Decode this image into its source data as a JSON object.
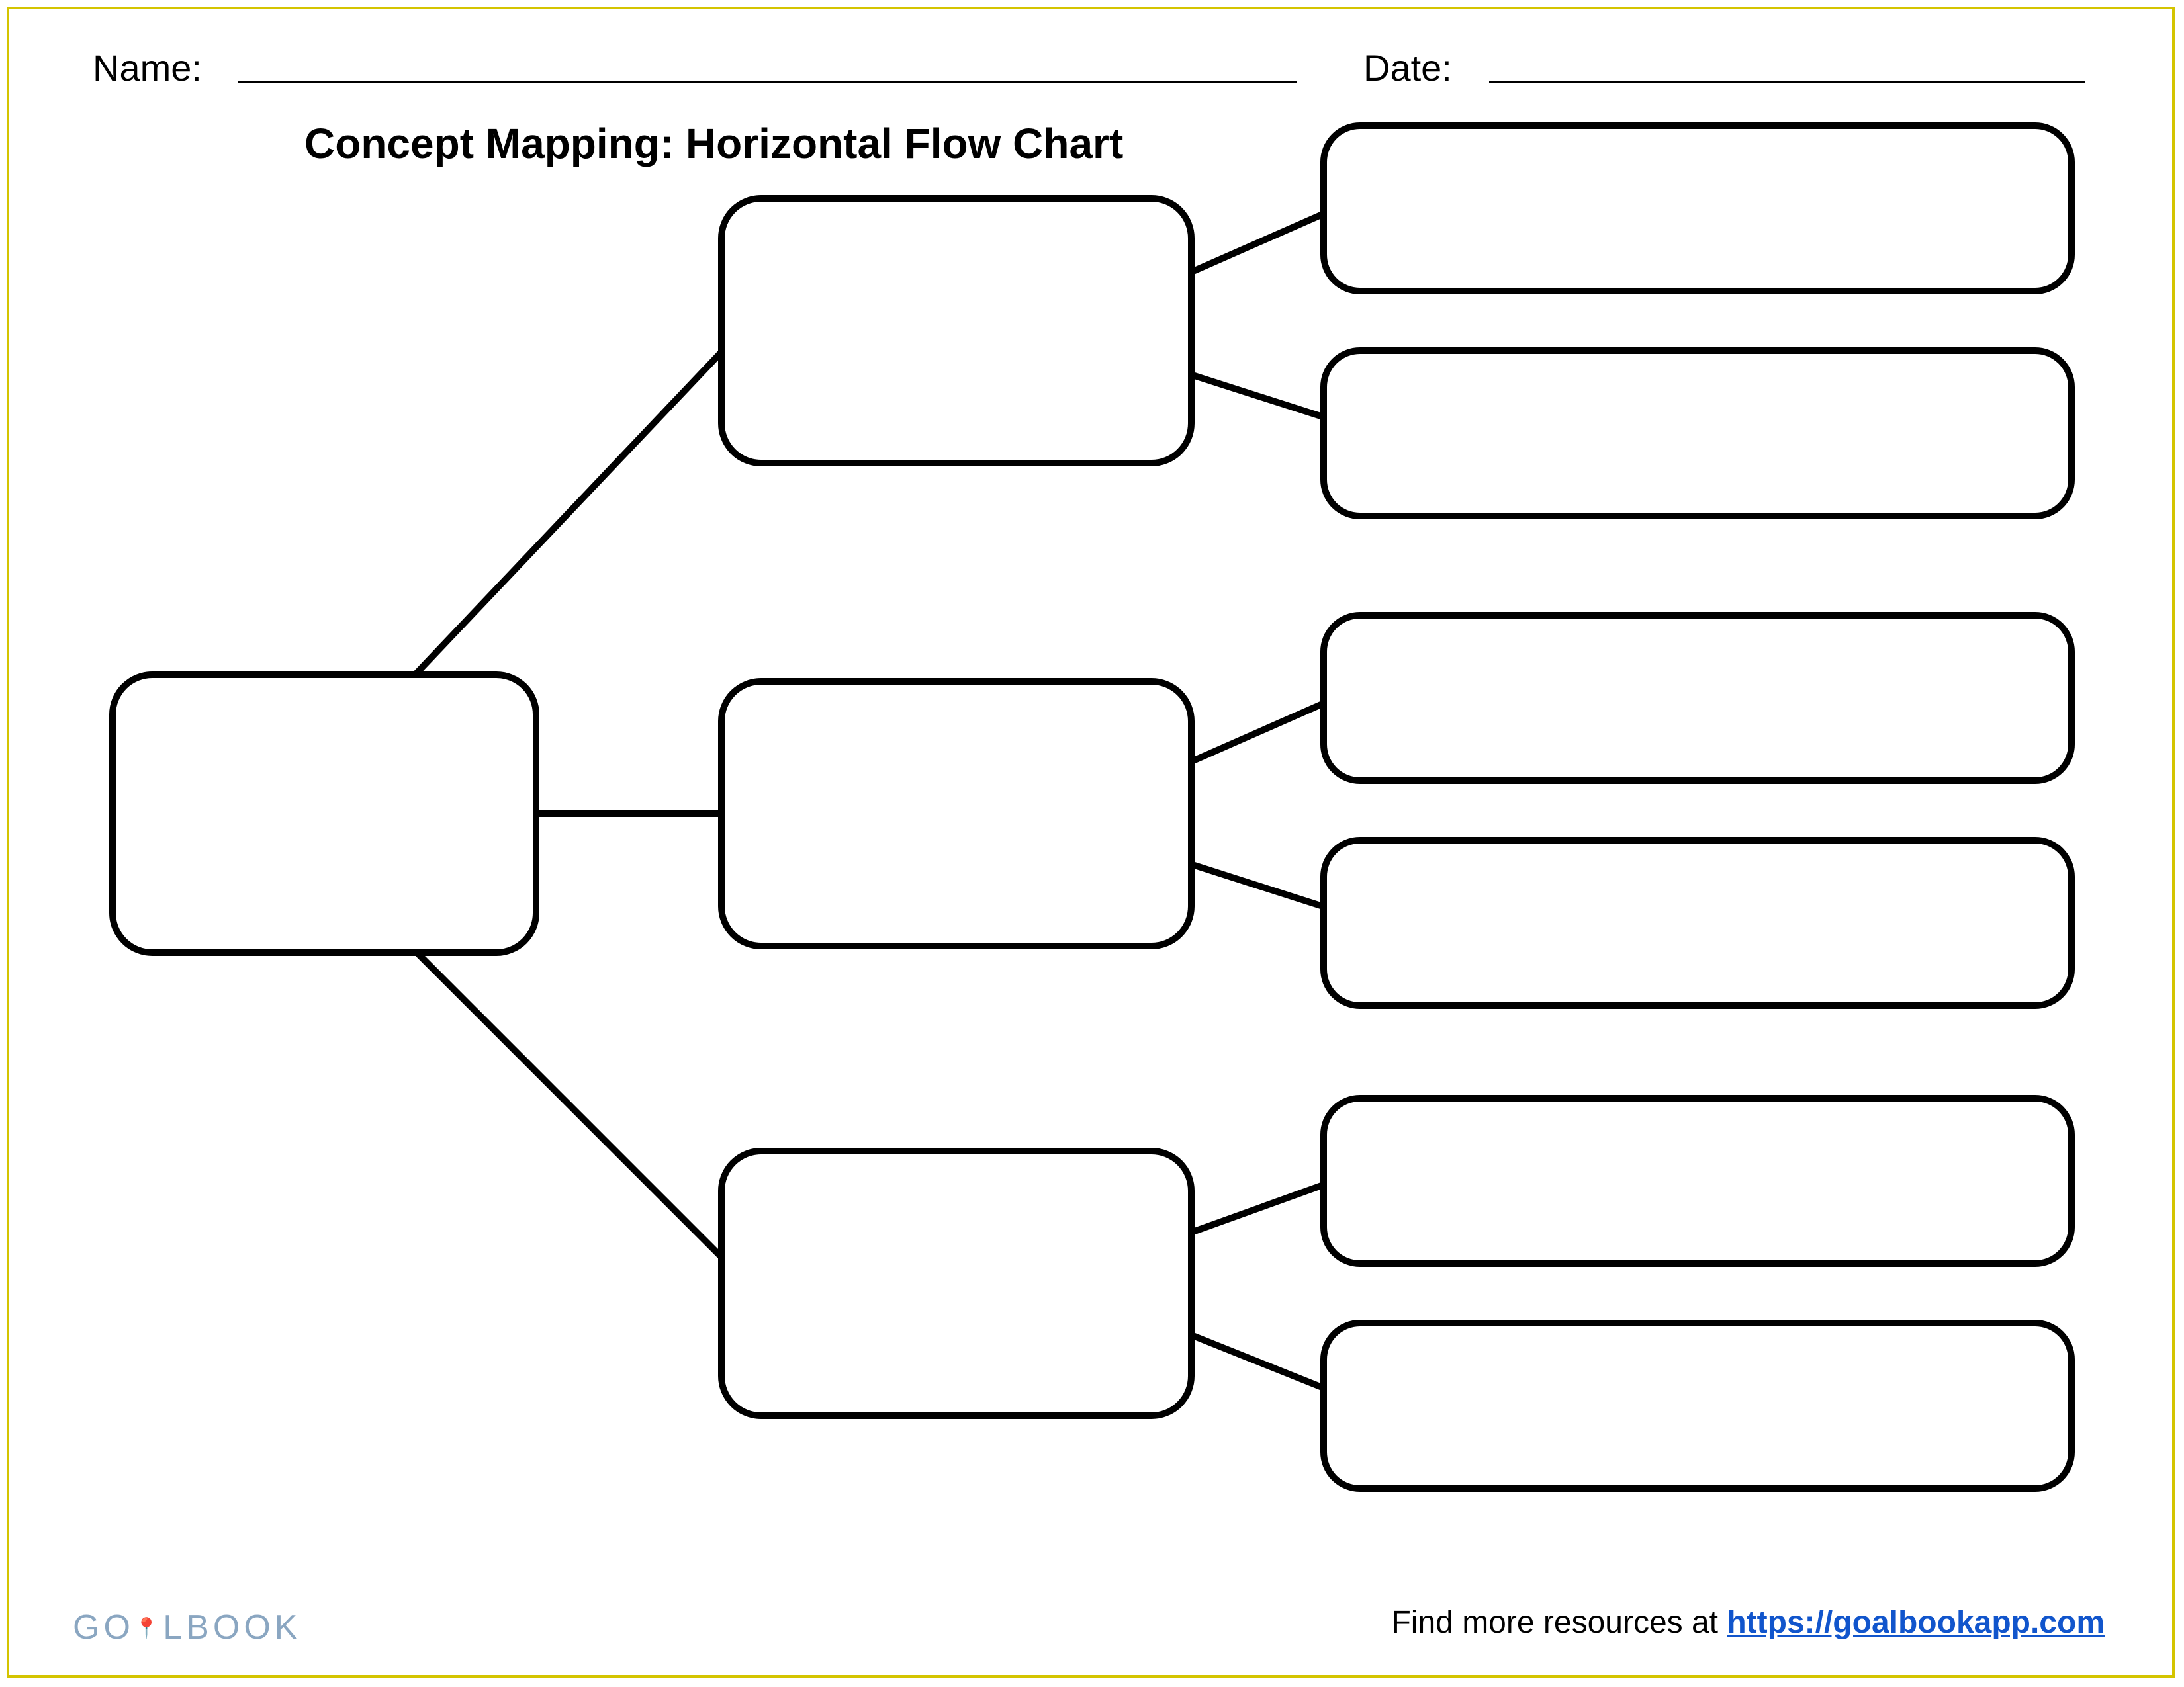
{
  "header": {
    "name_label": "Name:",
    "date_label": "Date:"
  },
  "title": "Concept Mapping: Horizontal Flow Chart",
  "footer": {
    "logo_text_1": "GO",
    "logo_text_2": "LBOOK",
    "resources_text": "Find more resources at ",
    "resources_link": "https://goalbookapp.com"
  },
  "diagram": {
    "root": "",
    "mid": [
      "",
      "",
      ""
    ],
    "leaves": [
      "",
      "",
      "",
      "",
      "",
      ""
    ]
  }
}
